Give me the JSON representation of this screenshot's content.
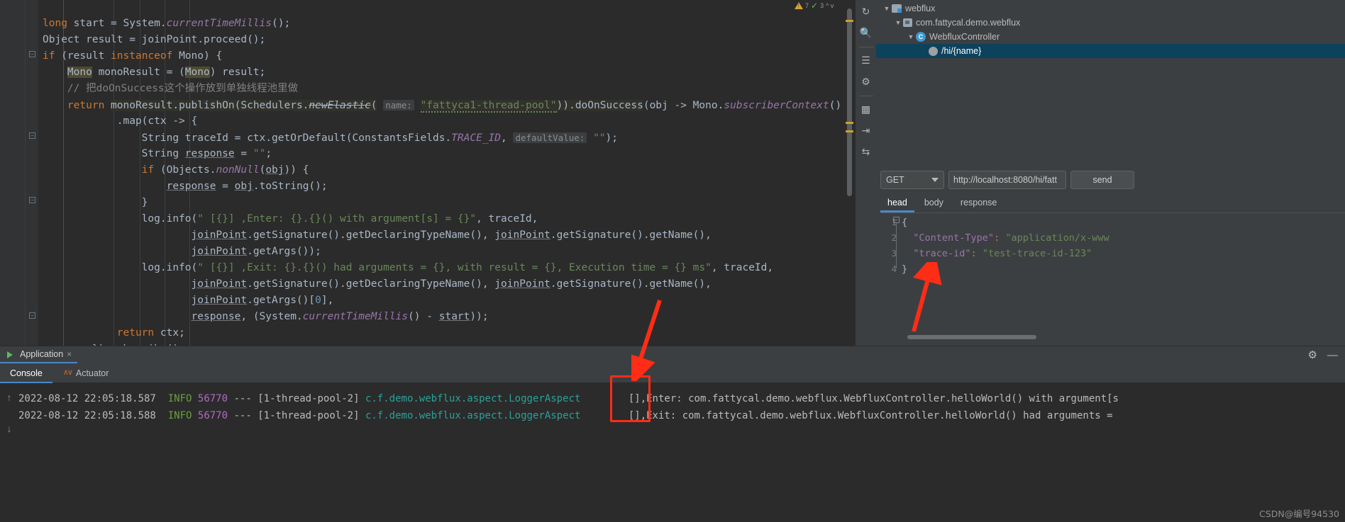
{
  "editor": {
    "lines": [
      "long start = System.currentTimeMillis();",
      "Object result = joinPoint.proceed();",
      "if (result instanceof Mono) {",
      "Mono monoResult = (Mono) result;",
      "// 把doOnSuccess这个操作放到单独线程池里做",
      "return monoResult.publishOn(Schedulers.newElastic( name: \"fattyca1-thread-pool\")).doOnSuccess(obj -> Mono.subscriberContext()",
      ".map(ctx -> {",
      "String traceId = ctx.getOrDefault(ConstantsFields.TRACE_ID,  defaultValue: \"\");",
      "String response = \"\";",
      "if (Objects.nonNull(obj)) {",
      "response = obj.toString();",
      "}",
      "log.info(\" [{}] ,Enter: {}.{}() with argument[s] = {}\", traceId,",
      "joinPoint.getSignature().getDeclaringTypeName(), joinPoint.getSignature().getName(),",
      "joinPoint.getArgs());",
      "log.info(\" [{}] ,Exit: {}.{}() had arguments = {}, with result = {}, Execution time = {} ms\", traceId,",
      "joinPoint.getSignature().getDeclaringTypeName(), joinPoint.getSignature().getName(),",
      "joinPoint.getArgs()[0],",
      "response, (System.currentTimeMillis() - start));",
      "return ctx;",
      "}).subscribe()"
    ],
    "param_hints": {
      "name": "name:",
      "default_value": "defaultValue:"
    },
    "thread_pool_name": "\"fattyca1-thread-pool\""
  },
  "tool_strip": {
    "icons": [
      "refresh-icon",
      "search-icon",
      "filter-icon",
      "settings-sliders-icon",
      "chart-bars-icon",
      "collapse-icon",
      "expand-icon"
    ]
  },
  "right_panel": {
    "tree": [
      {
        "label": "webflux",
        "icon": "folder-icon",
        "depth": 0,
        "selected": false,
        "expanded": true
      },
      {
        "label": "com.fattycal.demo.webflux",
        "icon": "package-icon",
        "depth": 1,
        "selected": false,
        "expanded": true
      },
      {
        "label": "WebfluxController",
        "icon": "class-icon",
        "depth": 2,
        "selected": false,
        "expanded": true
      },
      {
        "label": "/hi/{name}",
        "icon": "endpoint-icon",
        "depth": 3,
        "selected": true,
        "expanded": false
      }
    ],
    "request": {
      "method": "GET",
      "url": "http://localhost:8080/hi/fatt",
      "send_label": "send"
    },
    "tabs": [
      {
        "label": "head",
        "active": true
      },
      {
        "label": "body",
        "active": false
      },
      {
        "label": "response",
        "active": false
      }
    ],
    "json_lines": [
      {
        "n": "1",
        "text": "{"
      },
      {
        "n": "2",
        "key": "\"Content-Type\"",
        "value": "\"application/x-www"
      },
      {
        "n": "3",
        "key": "\"trace-id\"",
        "value": "\"test-trace-id-123\""
      },
      {
        "n": "4",
        "text": "}"
      }
    ]
  },
  "run_window": {
    "title": "Application",
    "close_label": "×",
    "settings_icon": "gear-icon",
    "minimize_icon": "minimize-icon"
  },
  "console": {
    "tabs": [
      {
        "label": "Console",
        "active": true
      },
      {
        "label": "Actuator",
        "active": false
      }
    ],
    "scroll_up_icon": "arrow-up-icon",
    "scroll_down_icon": "arrow-down-icon",
    "logs": [
      {
        "timestamp": "2022-08-12 22:05:18.587",
        "level": "INFO",
        "pid": "56770",
        "separator": "---",
        "thread": "[1-thread-pool-2]",
        "logger": "c.f.demo.webflux.aspect.LoggerAspect",
        "marker": "[]",
        "message": ",Enter: com.fattycal.demo.webflux.WebfluxController.helloWorld() with argument[s"
      },
      {
        "timestamp": "2022-08-12 22:05:18.588",
        "level": "INFO",
        "pid": "56770",
        "separator": "---",
        "thread": "[1-thread-pool-2]",
        "logger": "c.f.demo.webflux.aspect.LoggerAspect",
        "marker": "[]",
        "message": ",Exit: com.fattycal.demo.webflux.WebfluxController.helloWorld() had arguments ="
      }
    ]
  },
  "annotations": {
    "arrow_color": "#ff2d16",
    "box_color": "#ff2d16"
  },
  "watermark": "CSDN@编号94530"
}
